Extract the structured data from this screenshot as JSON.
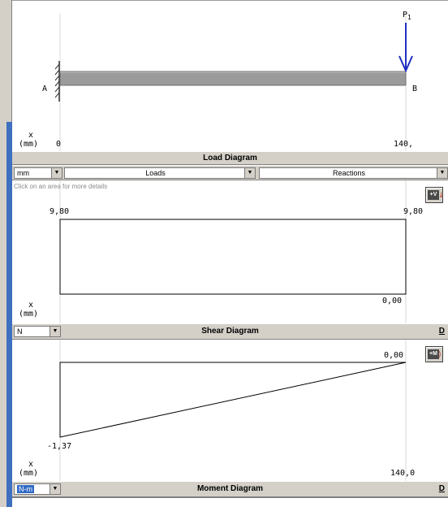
{
  "load_panel": {
    "point_a": "A",
    "point_b": "B",
    "load_label": "P",
    "load_subscript": "1",
    "x_label": "x",
    "x_unit": "(mm)",
    "x_start": "0",
    "x_end": "140,"
  },
  "load_bar": {
    "title": "Load Diagram",
    "unit_select": "mm",
    "loads_select": "Loads",
    "reactions_select": "Reactions"
  },
  "shear_panel": {
    "hint": "Click on an area for more details",
    "value_left_top": "9,80",
    "value_right_top": "9,80",
    "value_right_bottom": "0,00",
    "x_label": "x",
    "x_unit": "(mm)",
    "button_label": "+V"
  },
  "shear_bar": {
    "title": "Shear Diagram",
    "unit_select": "N",
    "d_label": "D"
  },
  "moment_panel": {
    "value_right_top": "0,00",
    "value_left_bottom": "-1,37",
    "x_label": "x",
    "x_unit": "(mm)",
    "x_end": "140,0",
    "button_label": "+M"
  },
  "moment_bar": {
    "title": "Moment Diagram",
    "unit_select": "N-m",
    "d_label": "D"
  },
  "colors": {
    "beam": "#9b9b9b",
    "load_arrow": "#1f2fbf",
    "bar_bg": "#d4d0c8",
    "selected": "#316ac5"
  }
}
